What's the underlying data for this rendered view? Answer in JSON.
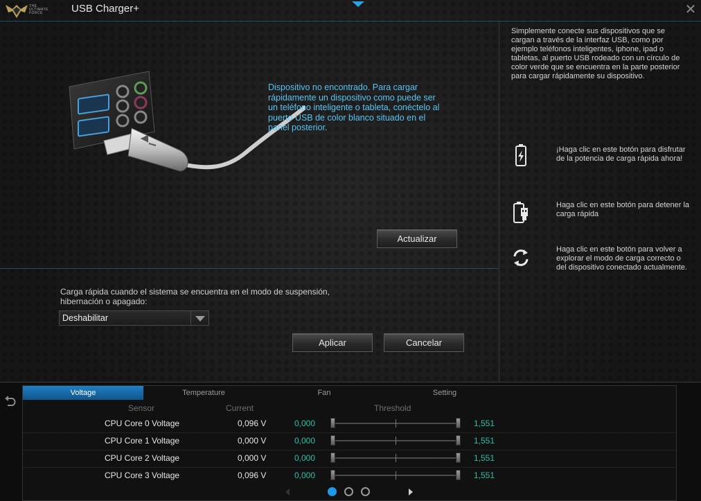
{
  "app": {
    "title": "USB Charger+",
    "logo_text": "THE ULTIMATE FORCE"
  },
  "main": {
    "status_message": "Dispositivo no encontrado. Para cargar rápidamente un dispositivo como puede ser un teléfono inteligente o tableta, conéctelo al puerto USB de color blanco situado en el panel posterior.",
    "refresh_label": "Actualizar",
    "sleep_label": "Carga rápida cuando el sistema se encuentra en el modo de suspensión, hibernación o apagado:",
    "sleep_select_value": "Deshabilitar",
    "apply_label": "Aplicar",
    "cancel_label": "Cancelar"
  },
  "help": {
    "intro": "Simplemente conecte sus dispositivos que se cargan a través de la interfaz USB, como por ejemplo teléfonos inteligentes, iphone, ipad o tabletas, al puerto USB rodeado con un círculo de color verde que se encuentra en la parte posterior para cargar rápidamente su dispositivo.",
    "items": [
      {
        "icon": "battery-charge-icon",
        "text": "¡Haga clic en este botón para disfrutar de la potencia de carga rápida ahora!"
      },
      {
        "icon": "battery-usb-icon",
        "text": "Haga clic en este botón para detener la carga rápida"
      },
      {
        "icon": "refresh-icon",
        "text": "Haga clic en este botón para volver a explorar el modo de carga correcto o del dispositivo conectado actualmente."
      }
    ]
  },
  "monitor": {
    "tabs": [
      "Voltage",
      "Temperature",
      "Fan",
      "Setting"
    ],
    "active_tab": "Voltage",
    "columns": {
      "sensor": "Sensor",
      "current": "Current",
      "threshold": "Threshold"
    },
    "rows": [
      {
        "sensor": "CPU Core 0 Voltage",
        "current": "0,096 V",
        "low": "0,000",
        "high": "1,551"
      },
      {
        "sensor": "CPU Core 1 Voltage",
        "current": "0,000 V",
        "low": "0,000",
        "high": "1,551"
      },
      {
        "sensor": "CPU Core 2 Voltage",
        "current": "0,000 V",
        "low": "0,000",
        "high": "1,551"
      },
      {
        "sensor": "CPU Core 3 Voltage",
        "current": "0,096 V",
        "low": "0,000",
        "high": "1,551"
      }
    ],
    "pager": {
      "pages": 3,
      "current": 1
    }
  },
  "colors": {
    "accent": "#1e9ae6",
    "info_text": "#57c4f2",
    "threshold_text": "#2bc1a8"
  }
}
